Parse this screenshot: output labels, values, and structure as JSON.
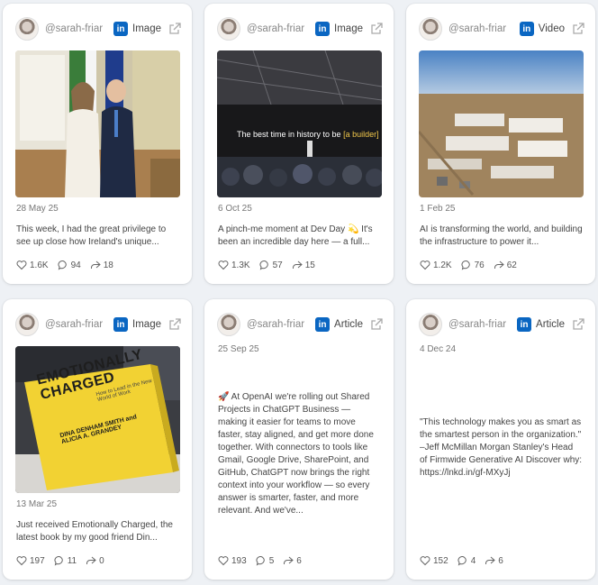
{
  "posts": [
    {
      "handle": "@sarah-friar",
      "type": "Image",
      "date": "28 May 25",
      "text": "This week, I had the great privilege to see up close how Ireland's unique...",
      "likes": "1.6K",
      "comments": "94",
      "shares": "18"
    },
    {
      "handle": "@sarah-friar",
      "type": "Image",
      "date": "6 Oct 25",
      "text": "A pinch-me moment at Dev Day 💫 It's been an incredible day here — a full...",
      "likes": "1.3K",
      "comments": "57",
      "shares": "15",
      "image_caption": "The best time in history to be",
      "image_caption_highlight": "[a builder]"
    },
    {
      "handle": "@sarah-friar",
      "type": "Video",
      "date": "1 Feb 25",
      "text": "AI is transforming the world, and building the infrastructure to power it...",
      "likes": "1.2K",
      "comments": "76",
      "shares": "62"
    },
    {
      "handle": "@sarah-friar",
      "type": "Image",
      "date": "13 Mar 25",
      "text": "Just received Emotionally Charged, the latest book by my good friend Din...",
      "likes": "197",
      "comments": "11",
      "shares": "0",
      "book_title": "EMOTIONALLY CHARGED",
      "book_subtitle": "How to Lead in the New World of Work",
      "book_authors": "DINA DENHAM SMITH and ALICIA A. GRANDEY"
    },
    {
      "handle": "@sarah-friar",
      "type": "Article",
      "date": "25 Sep 25",
      "text": "🚀 At OpenAI we're rolling out Shared Projects in ChatGPT Business — making it easier for teams to move faster, stay aligned, and get more done together. With connectors to tools like Gmail, Google Drive, SharePoint, and GitHub, ChatGPT now brings the right context into your workflow — so every answer is smarter, faster, and more relevant. And we've...",
      "likes": "193",
      "comments": "5",
      "shares": "6"
    },
    {
      "handle": "@sarah-friar",
      "type": "Article",
      "date": "4 Dec 24",
      "text": "\"This technology makes you as smart as the smartest person in the organization.\" –Jeff McMillan Morgan Stanley's Head of Firmwide Generative AI Discover why: https://lnkd.in/gf-MXyJj",
      "likes": "152",
      "comments": "4",
      "shares": "6"
    }
  ],
  "icons": {
    "linkedin": "linkedin-icon",
    "external": "external-link-icon",
    "like": "heart-icon",
    "comment": "comment-icon",
    "share": "share-icon"
  },
  "colors": {
    "linkedin": "#0a66c2",
    "background": "#eef1f5",
    "card": "#ffffff"
  }
}
